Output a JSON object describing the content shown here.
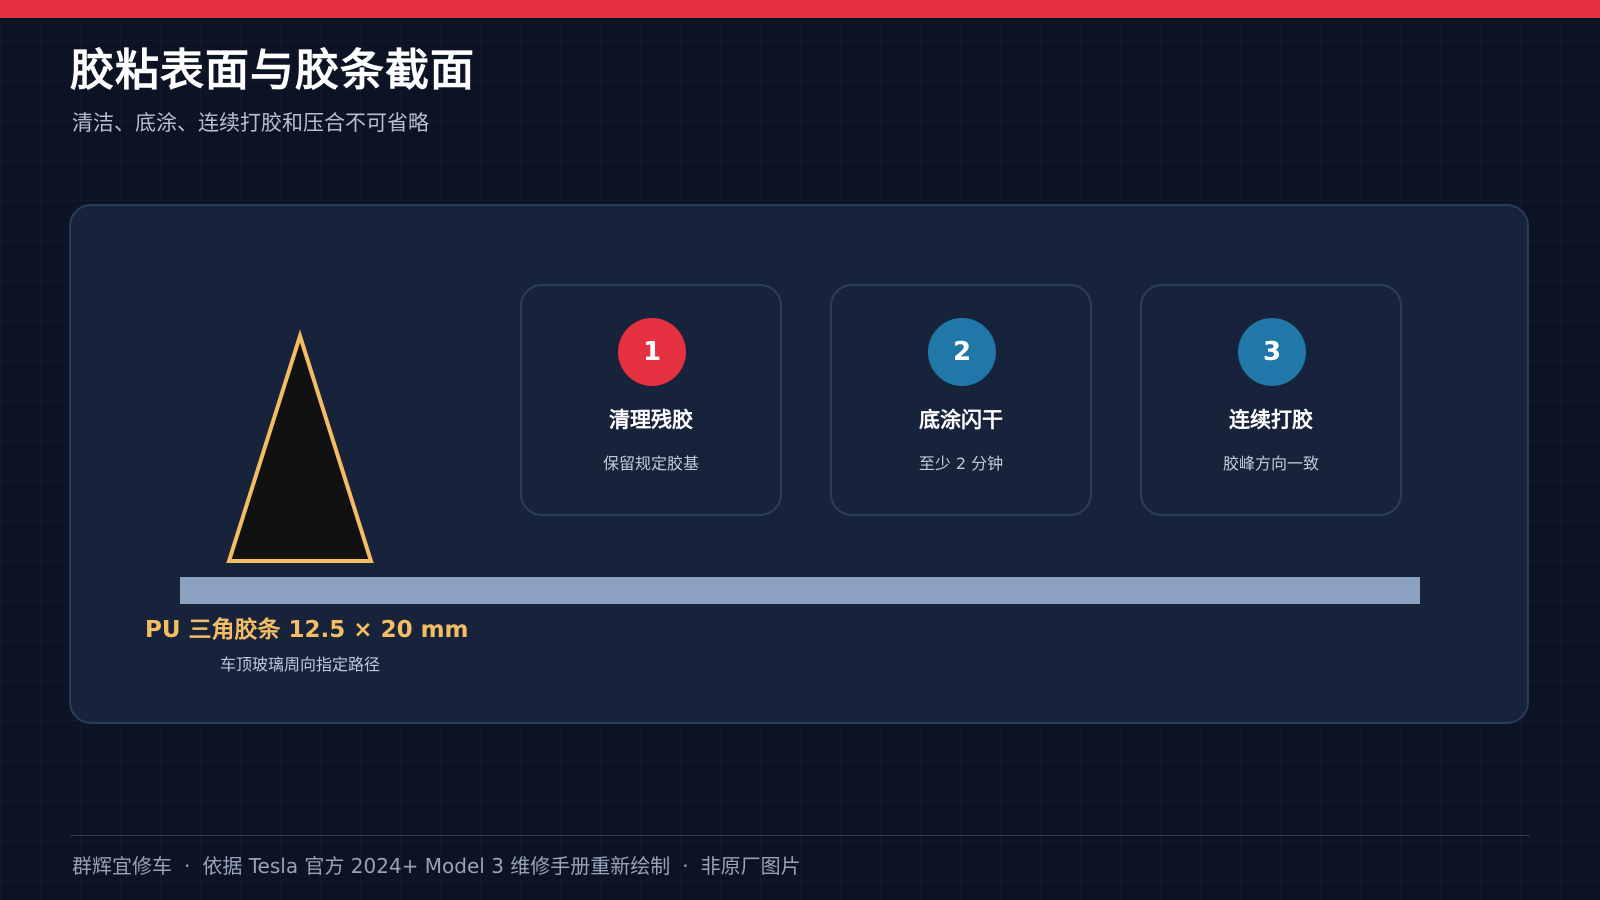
{
  "header": {
    "title": "胶粘表面与胶条截面",
    "subtitle": "清洁、底涂、连续打胶和压合不可省略"
  },
  "diagram": {
    "bead_label": "PU 三角胶条 12.5 × 20 mm",
    "bead_caption": "车顶玻璃周向指定路径",
    "colors": {
      "bead_fill": "#111111",
      "bead_outline": "#f5bd63",
      "substrate": "#8ca2c0"
    }
  },
  "steps": [
    {
      "number": "1",
      "title": "清理残胶",
      "desc": "保留规定胶基",
      "color": "#e63140"
    },
    {
      "number": "2",
      "title": "底涂闪干",
      "desc": "至少 2 分钟",
      "color": "#2178a8"
    },
    {
      "number": "3",
      "title": "连续打胶",
      "desc": "胶峰方向一致",
      "color": "#2178a8"
    }
  ],
  "footer": {
    "brand": "群辉宜修车",
    "source": "依据 Tesla 官方 2024+ Model 3 维修手册重新绘制",
    "note": "非原厂图片",
    "separator": "·"
  }
}
